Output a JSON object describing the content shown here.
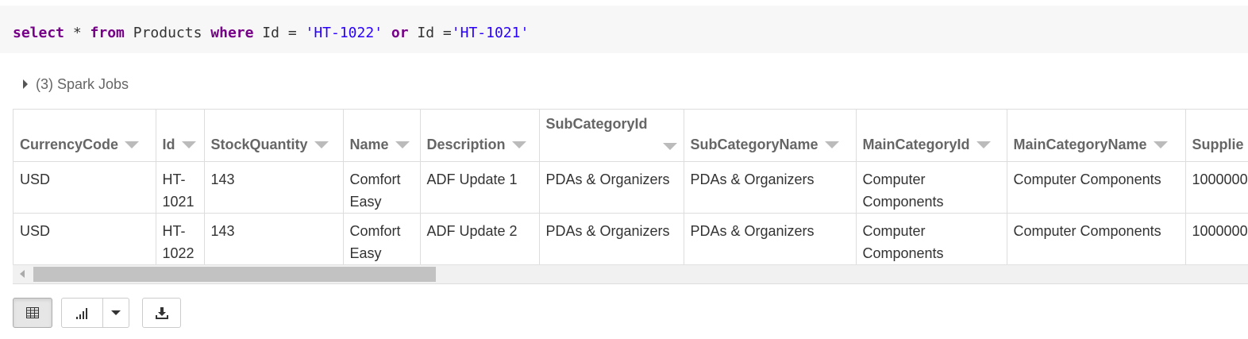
{
  "query": {
    "kw_select": "select",
    "star": " * ",
    "kw_from": "from",
    "table": " Products ",
    "kw_where": "where",
    "cond1": " Id = ",
    "val1": "'HT-1022'",
    "sp": " ",
    "kw_or": "or",
    "cond2": " Id =",
    "val2": "'HT-1021'"
  },
  "jobs": {
    "label": "(3) Spark Jobs"
  },
  "table": {
    "headers": [
      "CurrencyCode",
      "Id",
      "StockQuantity",
      "Name",
      "Description",
      "SubCategoryId",
      "SubCategoryName",
      "MainCategoryId",
      "MainCategoryName",
      "Supplie"
    ],
    "rows": [
      [
        "USD",
        "HT-1021",
        "143",
        "Comfort Easy",
        "ADF Update 1",
        "PDAs & Organizers",
        "PDAs & Organizers",
        "Computer Components",
        "Computer Components",
        "1000000"
      ],
      [
        "USD",
        "HT-1022",
        "143",
        "Comfort Easy",
        "ADF Update 2",
        "PDAs & Organizers",
        "PDAs & Organizers",
        "Computer Components",
        "Computer Components",
        "1000000"
      ]
    ]
  },
  "toolbar": {
    "table_icon": "table-icon",
    "chart_icon": "bar-chart-icon",
    "dropdown_icon": "chevron-down-icon",
    "download_icon": "download-icon"
  }
}
